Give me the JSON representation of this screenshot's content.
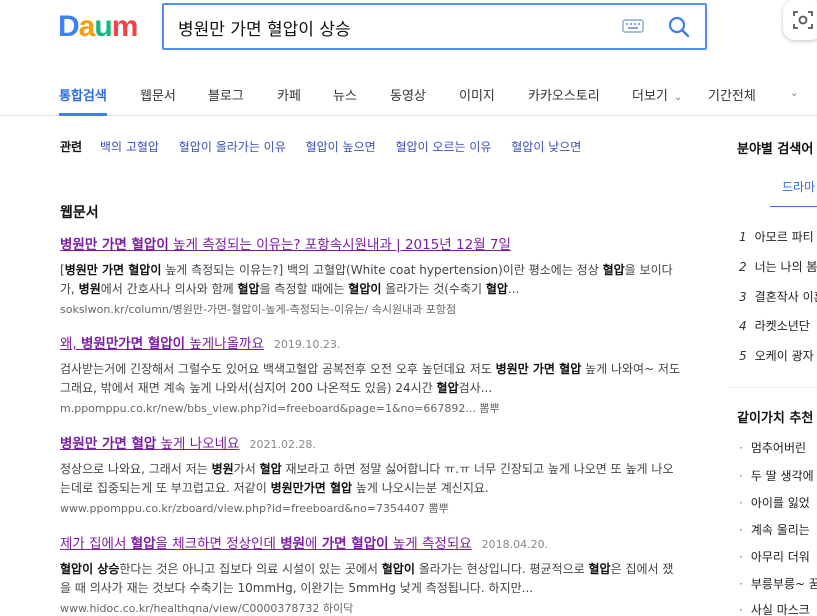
{
  "header": {
    "logo": [
      "D",
      "a",
      "u",
      "m"
    ],
    "logo_colors": [
      "#3B82F6",
      "#F59E0B",
      "#10B981",
      "#EF4444"
    ],
    "search_value": "병원만 가면 혈압이 상승"
  },
  "tabs": [
    {
      "label": "통합검색",
      "active": true
    },
    {
      "label": "웹문서"
    },
    {
      "label": "블로그"
    },
    {
      "label": "카페"
    },
    {
      "label": "뉴스"
    },
    {
      "label": "동영상"
    },
    {
      "label": "이미지"
    },
    {
      "label": "카카오스토리"
    },
    {
      "label": "더보기"
    },
    {
      "label": "기간전체"
    }
  ],
  "related": {
    "label": "관련",
    "items": [
      "백의 고혈압",
      "혈압이 올라가는 이유",
      "혈압이 높으면",
      "혈압이 오르는 이유",
      "혈압이 낮으면"
    ]
  },
  "section_title": "웹문서",
  "results": [
    {
      "title_parts": [
        [
          "b",
          "병원만 가면 혈압이"
        ],
        [
          "t",
          " 높게 측정되는 이유는? 포항속시원내과 | 2015년 12월 7일"
        ]
      ],
      "date": "",
      "desc_parts": [
        [
          "t",
          "["
        ],
        [
          "b",
          "병원만 가면 혈압이"
        ],
        [
          "t",
          " 높게 측정되는 이유는?] 백의 고혈압(White coat hypertension)이란 평소에는 정상 "
        ],
        [
          "b",
          "혈압"
        ],
        [
          "t",
          "을 보이다가, "
        ],
        [
          "b",
          "병원"
        ],
        [
          "t",
          "에서 간호사나 의사와 함께 "
        ],
        [
          "b",
          "혈압"
        ],
        [
          "t",
          "을 측정할 때에는 "
        ],
        [
          "b",
          "혈압이"
        ],
        [
          "t",
          " 올라가는 것(수축기 "
        ],
        [
          "b",
          "혈압"
        ],
        [
          "t",
          "..."
        ]
      ],
      "url": "sokslwon.kr/column/병원만-가면-혈압이-높게-측정되는-이유는/ 속시원내과 포항점"
    },
    {
      "title_parts": [
        [
          "t",
          "왜, "
        ],
        [
          "b",
          "병원만가면 혈압이"
        ],
        [
          "t",
          " 높게나올까요"
        ]
      ],
      "date": "2019.10.23.",
      "desc_parts": [
        [
          "t",
          "검사받는거에 긴장해서 그럴수도 있어요 백색고혈압 공복전후 오전 오후 높던데요 저도 "
        ],
        [
          "b",
          "병원만 가면 혈압"
        ],
        [
          "t",
          " 높게 나와여~ 저도 그래요, 밖에서 재면 계속 높게 나와서(심지어 200 나온적도 있음) 24시간 "
        ],
        [
          "b",
          "혈압"
        ],
        [
          "t",
          "검사..."
        ]
      ],
      "url": "m.ppomppu.co.kr/new/bbs_view.php?id=freeboard&page=1&no=667892... 뽐뿌"
    },
    {
      "title_parts": [
        [
          "b",
          "병원만 가면 혈압"
        ],
        [
          "t",
          " 높게 나오네요"
        ]
      ],
      "date": "2021.02.28.",
      "desc_parts": [
        [
          "t",
          "정상으로 나와요, 그래서 저는 "
        ],
        [
          "b",
          "병원"
        ],
        [
          "t",
          "가서 "
        ],
        [
          "b",
          "혈압"
        ],
        [
          "t",
          " 재보라고 하면 정말 싫어합니다 ㅠ.ㅠ 너무 긴장되고 높게 나오면 또 높게 나오는데로 집중되는게 또 부끄럽고요. 저같이 "
        ],
        [
          "b",
          "병원만가면 혈압"
        ],
        [
          "t",
          " 높게 나오시는분 계신지요."
        ]
      ],
      "url": "www.ppomppu.co.kr/zboard/view.php?id=freeboard&no=7354407 뽐뿌"
    },
    {
      "title_parts": [
        [
          "t",
          "제가 집에서 "
        ],
        [
          "b",
          "혈압"
        ],
        [
          "t",
          "을 체크하면 정상인데 "
        ],
        [
          "b",
          "병원"
        ],
        [
          "t",
          "에 "
        ],
        [
          "b",
          "가면 혈압이"
        ],
        [
          "t",
          " 높게 측정되요"
        ]
      ],
      "date": "2018.04.20.",
      "desc_parts": [
        [
          "b",
          "혈압이 상승"
        ],
        [
          "t",
          "한다는 것은 아니고 집보다 의료 시설이 있는 곳에서 "
        ],
        [
          "b",
          "혈압이"
        ],
        [
          "t",
          " 올라가는 현상입니다. 평균적으로 "
        ],
        [
          "b",
          "혈압"
        ],
        [
          "t",
          "은 집에서 쟀을 때 의사가 재는 것보다 수축기는 10mmHg, 이완기는 5mmHg 낮게 측정됩니다. 하지만..."
        ]
      ],
      "url": "www.hidoc.co.kr/healthqna/view/C0000378732 하이닥"
    }
  ],
  "right_panel": {
    "title": "분야별 검색어",
    "tab": "드라마",
    "ranks": [
      {
        "num": "1",
        "label": "아모르 파티"
      },
      {
        "num": "2",
        "label": "너는 나의 봄"
      },
      {
        "num": "3",
        "label": "결혼작사 이혼"
      },
      {
        "num": "4",
        "label": "라켓소년단"
      },
      {
        "num": "5",
        "label": "오케이 광자"
      }
    ],
    "title2": "같이가치 추천",
    "bullets": [
      "멈추어버린 ",
      "두 딸 생각에",
      "아이를 잃었",
      "계속 울리는",
      "아무리 더워",
      "부릉부릉~ 꿈",
      "사실 마스크"
    ]
  }
}
